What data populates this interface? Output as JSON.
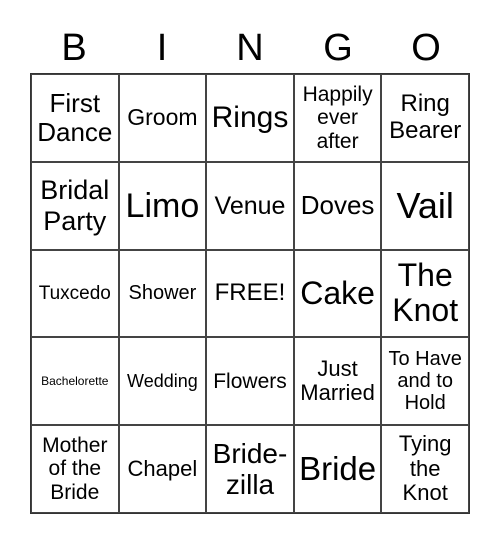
{
  "header": [
    "B",
    "I",
    "N",
    "G",
    "O"
  ],
  "cells": [
    {
      "text": "First\nDance",
      "size": 26
    },
    {
      "text": "Groom",
      "size": 23
    },
    {
      "text": "Rings",
      "size": 30
    },
    {
      "text": "Happily\never\nafter",
      "size": 21
    },
    {
      "text": "Ring\nBearer",
      "size": 24
    },
    {
      "text": "Bridal\nParty",
      "size": 27
    },
    {
      "text": "Limo",
      "size": 34
    },
    {
      "text": "Venue",
      "size": 25
    },
    {
      "text": "Doves",
      "size": 26
    },
    {
      "text": "Vail",
      "size": 36
    },
    {
      "text": "Tuxcedo",
      "size": 19
    },
    {
      "text": "Shower",
      "size": 20
    },
    {
      "text": "FREE!",
      "size": 24
    },
    {
      "text": "Cake",
      "size": 32
    },
    {
      "text": "The\nKnot",
      "size": 32
    },
    {
      "text": "Bachelorette",
      "size": 12
    },
    {
      "text": "Wedding",
      "size": 18
    },
    {
      "text": "Flowers",
      "size": 21
    },
    {
      "text": "Just\nMarried",
      "size": 22
    },
    {
      "text": "To Have\nand to\nHold",
      "size": 20
    },
    {
      "text": "Mother\nof the\nBride",
      "size": 21
    },
    {
      "text": "Chapel",
      "size": 22
    },
    {
      "text": "Bride-\nzilla",
      "size": 28
    },
    {
      "text": "Bride",
      "size": 33
    },
    {
      "text": "Tying\nthe\nKnot",
      "size": 22
    }
  ]
}
